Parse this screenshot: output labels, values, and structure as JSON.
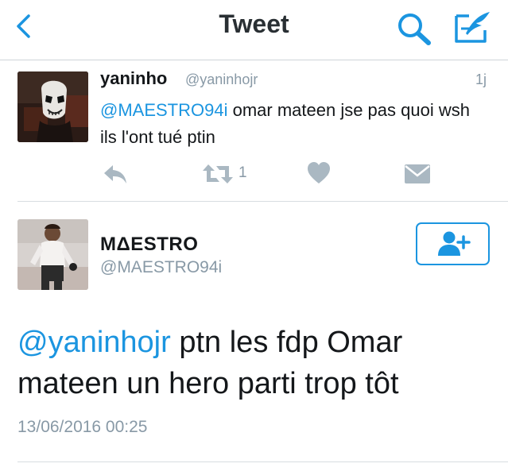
{
  "header": {
    "title": "Tweet",
    "back_icon": "chevron-left-icon",
    "search_icon": "search-icon",
    "compose_icon": "compose-tweet-icon",
    "accent": "#1b95e0"
  },
  "reply_tweet": {
    "name": "yaninho",
    "handle": "@yaninhojr",
    "time": "1j",
    "mention": "@MAESTRO94i",
    "text": " omar mateen jse pas quoi wsh ils l'ont tué ptin",
    "actions": {
      "reply_icon": "reply-icon",
      "retweet_icon": "retweet-icon",
      "retweet_count": "1",
      "like_icon": "heart-icon",
      "dm_icon": "direct-message-icon"
    }
  },
  "main_tweet": {
    "name": "MΔESTRO",
    "handle": "@MAESTRO94i",
    "follow_icon": "add-user-icon",
    "mention": "@yaninhojr",
    "text": " ptn les fdp Omar mateen un hero parti trop tôt",
    "date": "13/06/2016 00:25"
  }
}
